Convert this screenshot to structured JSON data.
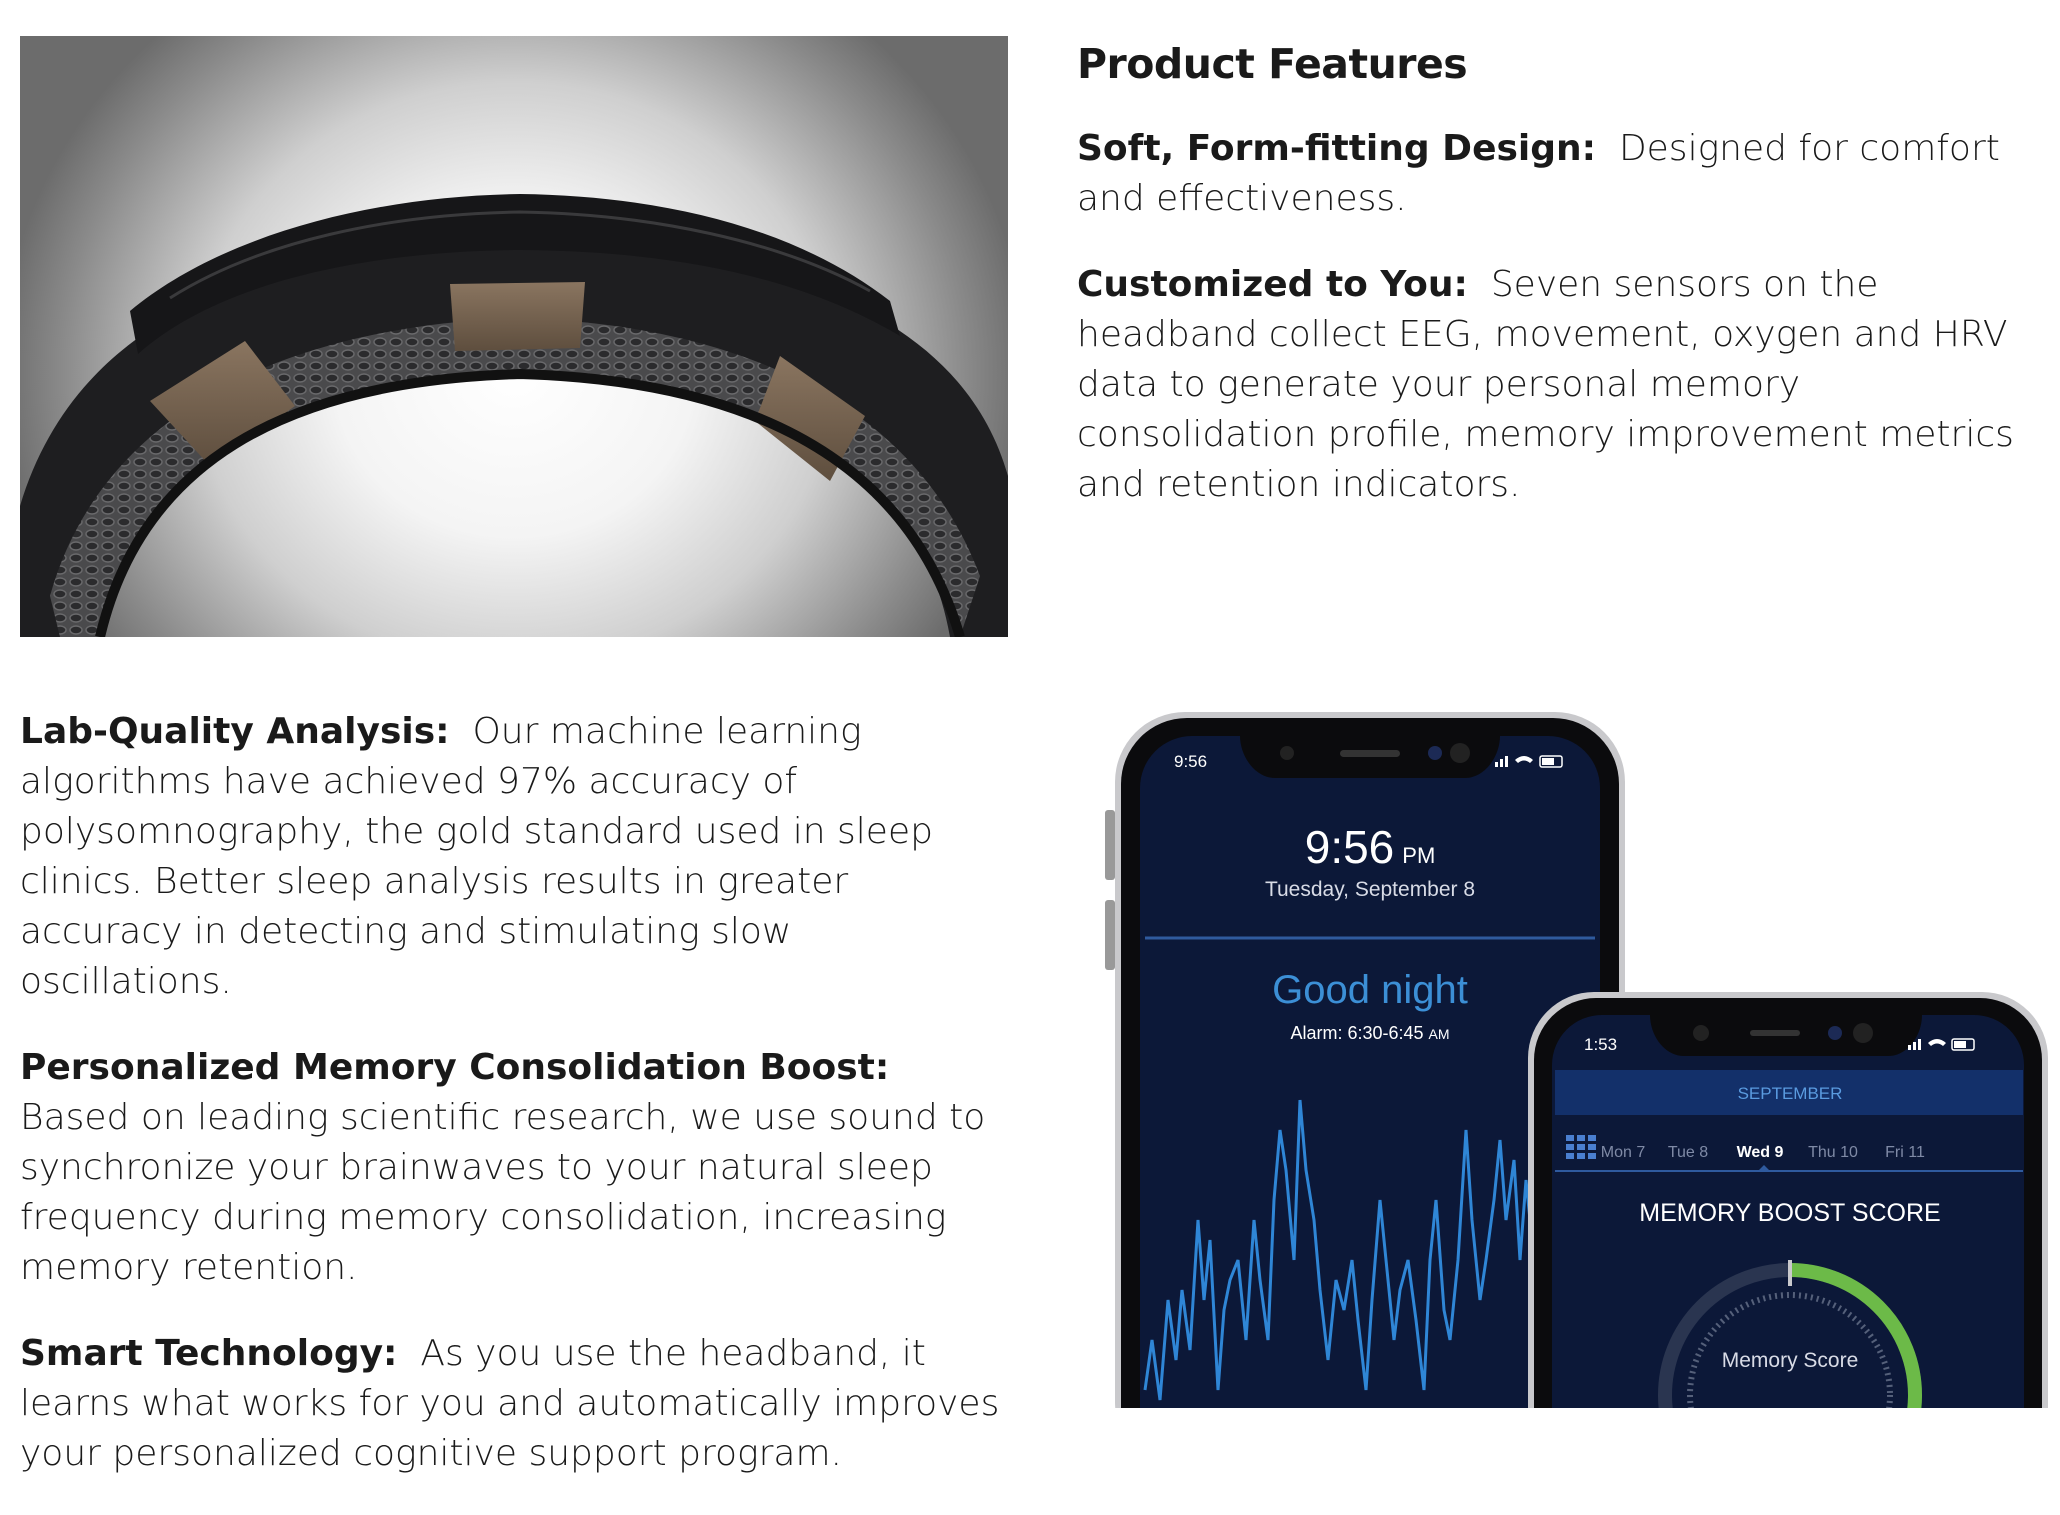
{
  "features": {
    "heading": "Product Features",
    "items": [
      {
        "title": "Soft, Form-fitting Design:",
        "text": "Designed for comfort and effectiveness."
      },
      {
        "title": "Customized to You:",
        "text": "Seven sensors on the headband collect EEG, movement, oxygen and HRV data to generate your personal memory consolidation profile, memory improvement metrics and retention indicators."
      },
      {
        "title": "Lab-Quality Analysis:",
        "text": "Our machine learning algorithms have achieved 97% accuracy of polysomnography, the gold standard used in sleep clinics. Better sleep analysis results in greater accuracy in detecting and stimulating slow oscillations."
      },
      {
        "title": "Personalized Memory Consolidation Boost:",
        "text": "Based on leading scientific research, we use sound to synchronize your brainwaves to your natural sleep frequency during memory consolidation, increasing memory retention."
      },
      {
        "title": "Smart Technology:",
        "text": "As you use the headband, it learns what works for you and automatically improves your personalized cognitive support program."
      }
    ]
  },
  "phone_left": {
    "status_time": "9:56",
    "clock": "9:56",
    "ampm": "PM",
    "date": "Tuesday, September 8",
    "greeting": "Good night",
    "alarm": "Alarm: 6:30-6:45",
    "alarm_ampm": "AM"
  },
  "phone_right": {
    "status_time": "1:53",
    "month": "SEPTEMBER",
    "days": [
      "Mon 7",
      "Tue 8",
      "Wed 9",
      "Thu 10",
      "Fri 11"
    ],
    "selected_day": "Wed 9",
    "score_title": "MEMORY BOOST SCORE",
    "score_label": "Memory Score",
    "score_fill": 0.62
  },
  "colors": {
    "screen": "#0c1838",
    "accent": "#3c8fd6",
    "ring": "#6cba48"
  }
}
